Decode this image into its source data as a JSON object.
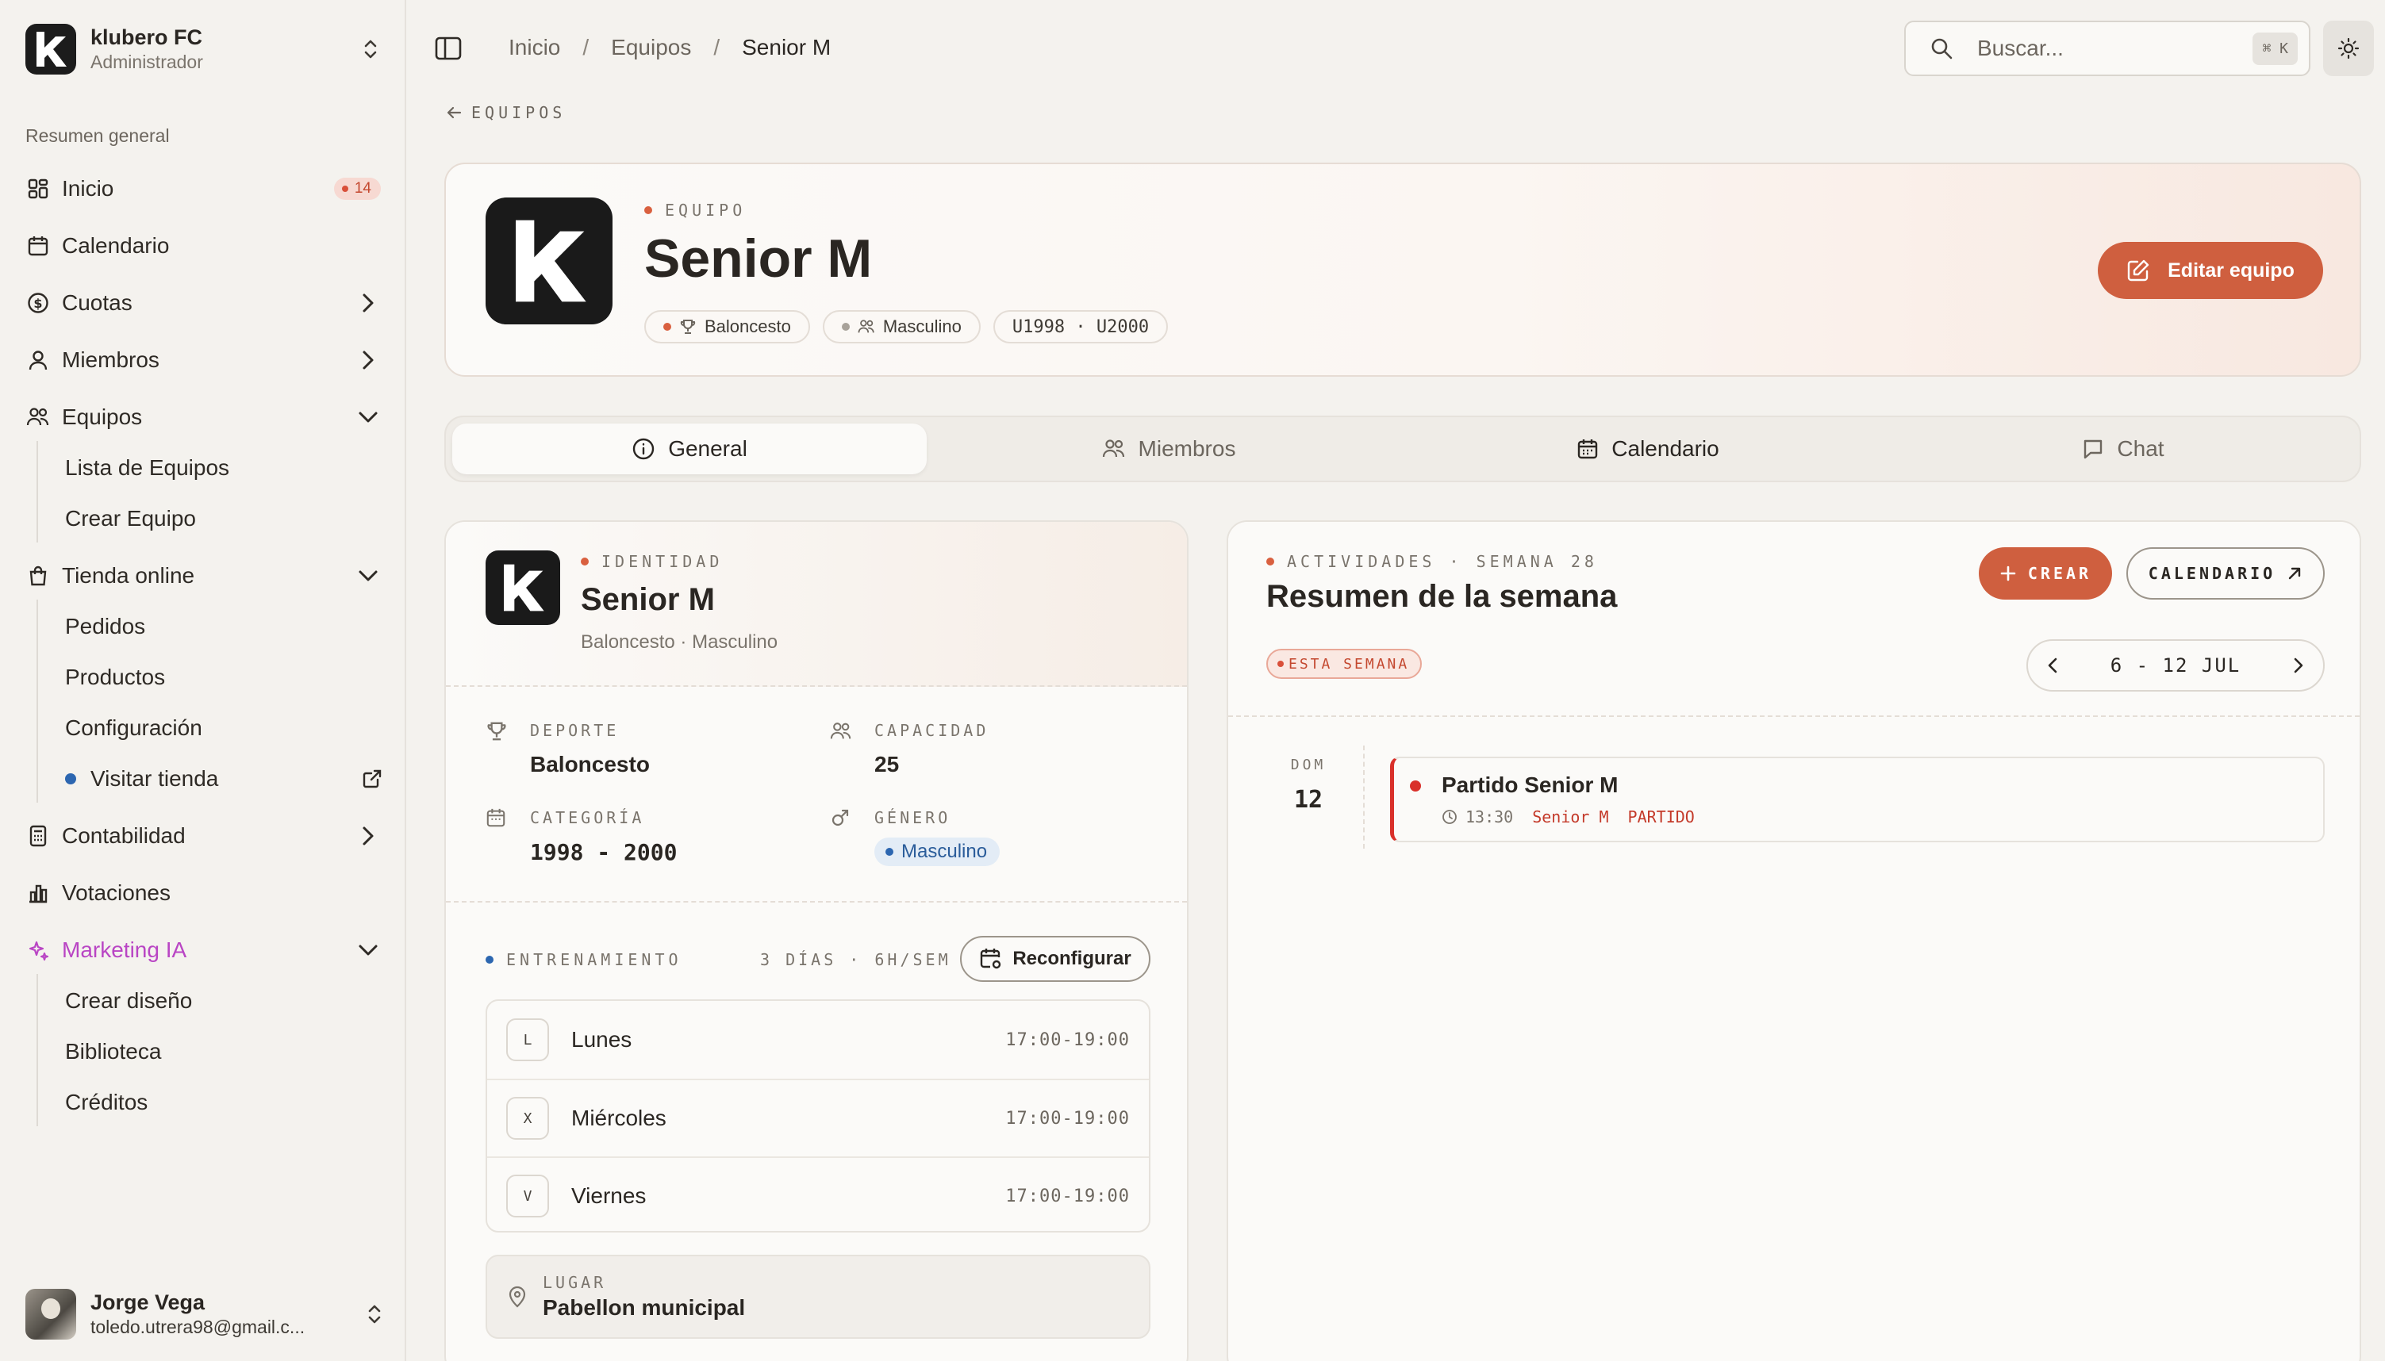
{
  "app": {
    "name": "klubero FC",
    "role": "Administrador"
  },
  "sidebar": {
    "section_label": "Resumen general",
    "items": {
      "inicio": {
        "label": "Inicio",
        "badge": "14"
      },
      "calendario": {
        "label": "Calendario"
      },
      "cuotas": {
        "label": "Cuotas"
      },
      "miembros": {
        "label": "Miembros"
      },
      "equipos": {
        "label": "Equipos",
        "children": [
          "Lista de Equipos",
          "Crear Equipo"
        ]
      },
      "tienda": {
        "label": "Tienda online",
        "children": [
          "Pedidos",
          "Productos",
          "Configuración",
          "Visitar tienda"
        ]
      },
      "contabilidad": {
        "label": "Contabilidad"
      },
      "votaciones": {
        "label": "Votaciones"
      },
      "marketing": {
        "label": "Marketing IA",
        "color": "#b945c4",
        "children": [
          "Crear diseño",
          "Biblioteca",
          "Créditos"
        ]
      }
    },
    "user": {
      "name": "Jorge Vega",
      "email": "toledo.utrera98@gmail.c..."
    }
  },
  "topbar": {
    "breadcrumbs": [
      "Inicio",
      "Equipos",
      "Senior M"
    ],
    "search_placeholder": "Buscar...",
    "search_shortcut": "⌘ K"
  },
  "back_link": "EQUIPOS",
  "team": {
    "eyebrow": "EQUIPO",
    "name": "Senior M",
    "chips": {
      "sport": "Baloncesto",
      "gender": "Masculino",
      "years": "U1998 · U2000"
    },
    "edit_label": "Editar equipo"
  },
  "tabs": [
    "General",
    "Miembros",
    "Calendario",
    "Chat"
  ],
  "identity": {
    "eyebrow": "IDENTIDAD",
    "name": "Senior M",
    "subtitle": "Baloncesto · Masculino",
    "stats": {
      "deporte": {
        "label": "DEPORTE",
        "value": "Baloncesto"
      },
      "capacidad": {
        "label": "CAPACIDAD",
        "value": "25"
      },
      "categoria": {
        "label": "CATEGORÍA",
        "value": "1998 - 2000"
      },
      "genero": {
        "label": "GÉNERO",
        "value": "Masculino"
      }
    }
  },
  "training": {
    "eyebrow": "ENTRENAMIENTO",
    "meta": "3 DÍAS · 6H/SEM",
    "reconfig_label": "Reconfigurar",
    "days": [
      {
        "key": "L",
        "name": "Lunes",
        "time": "17:00-19:00"
      },
      {
        "key": "X",
        "name": "Miércoles",
        "time": "17:00-19:00"
      },
      {
        "key": "V",
        "name": "Viernes",
        "time": "17:00-19:00"
      }
    ],
    "place_label": "LUGAR",
    "place_value": "Pabellon municipal"
  },
  "activities": {
    "eyebrow": "ACTIVIDADES · SEMANA 28",
    "title": "Resumen de la semana",
    "week_pill": "ESTA SEMANA",
    "create_label": "CREAR",
    "calendar_label": "CALENDARIO",
    "week_range": "6 - 12 JUL",
    "events": [
      {
        "day_label": "DOM",
        "day_num": "12",
        "title": "Partido Senior M",
        "time": "13:30",
        "team": "Senior M",
        "type": "PARTIDO",
        "color": "#d9302a"
      }
    ]
  },
  "colors": {
    "accent": "#cf5f3f",
    "marketing": "#b945c4",
    "blue": "#2c66b0",
    "event": "#d9302a"
  }
}
